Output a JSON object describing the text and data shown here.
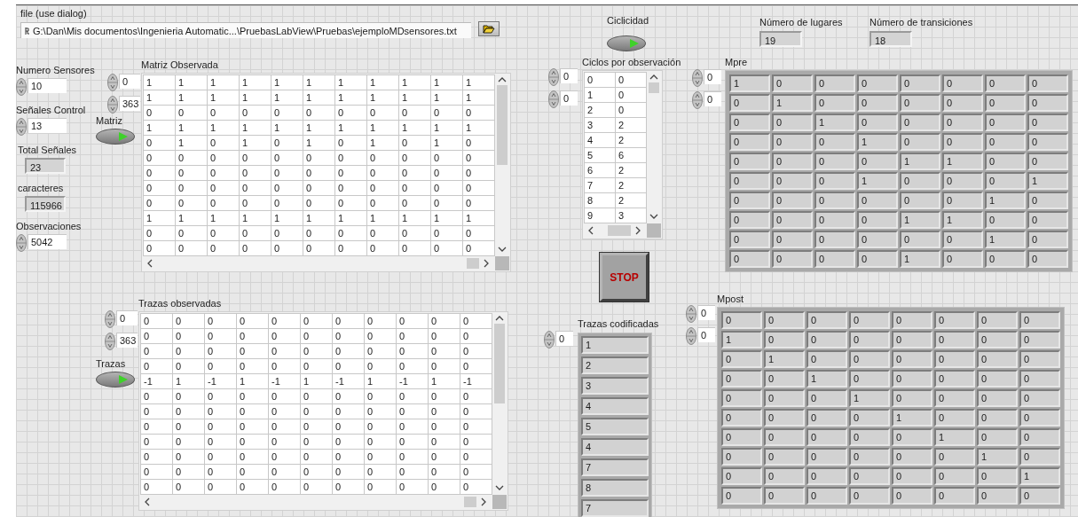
{
  "file_path": {
    "label": "file (use dialog)",
    "value": "G:\\Dan\\Mis documentos\\Ingenieria Automatic...\\PruebasLabView\\Pruebas\\ejemploMDsensores.txt"
  },
  "numerics": [
    {
      "kind": "control",
      "label": "Numero Sensores",
      "value": "10"
    },
    {
      "kind": "control",
      "label": "Señales Control",
      "value": "13"
    },
    {
      "kind": "indicator",
      "label": "Total Señales",
      "value": "23"
    },
    {
      "kind": "indicator",
      "label": "caracteres",
      "value": "115966"
    },
    {
      "kind": "control",
      "label": "Observaciones",
      "value": "5042"
    }
  ],
  "matriz_observada": {
    "label": "Matriz Observada",
    "index": [
      "0",
      "363"
    ],
    "toggle": {
      "label": "Matriz",
      "on": true
    },
    "rows": [
      [
        "1",
        "1",
        "1",
        "1",
        "1",
        "1",
        "1",
        "1",
        "1",
        "1",
        "1"
      ],
      [
        "1",
        "1",
        "1",
        "1",
        "1",
        "1",
        "1",
        "1",
        "1",
        "1",
        "1"
      ],
      [
        "0",
        "0",
        "0",
        "0",
        "0",
        "0",
        "0",
        "0",
        "0",
        "0",
        "0"
      ],
      [
        "1",
        "1",
        "1",
        "1",
        "1",
        "1",
        "1",
        "1",
        "1",
        "1",
        "1"
      ],
      [
        "0",
        "1",
        "0",
        "1",
        "0",
        "1",
        "0",
        "1",
        "0",
        "1",
        "0"
      ],
      [
        "0",
        "0",
        "0",
        "0",
        "0",
        "0",
        "0",
        "0",
        "0",
        "0",
        "0"
      ],
      [
        "0",
        "0",
        "0",
        "0",
        "0",
        "0",
        "0",
        "0",
        "0",
        "0",
        "0"
      ],
      [
        "0",
        "0",
        "0",
        "0",
        "0",
        "0",
        "0",
        "0",
        "0",
        "0",
        "0"
      ],
      [
        "0",
        "0",
        "0",
        "0",
        "0",
        "0",
        "0",
        "0",
        "0",
        "0",
        "0"
      ],
      [
        "1",
        "1",
        "1",
        "1",
        "1",
        "1",
        "1",
        "1",
        "1",
        "1",
        "1"
      ],
      [
        "0",
        "0",
        "0",
        "0",
        "0",
        "0",
        "0",
        "0",
        "0",
        "0",
        "0"
      ],
      [
        "0",
        "0",
        "0",
        "0",
        "0",
        "0",
        "0",
        "0",
        "0",
        "0",
        "0"
      ]
    ]
  },
  "trazas_observadas": {
    "label": "Trazas observadas",
    "index": [
      "0",
      "363"
    ],
    "toggle": {
      "label": "Trazas",
      "on": true
    },
    "rows": [
      [
        "0",
        "0",
        "0",
        "0",
        "0",
        "0",
        "0",
        "0",
        "0",
        "0",
        "0"
      ],
      [
        "0",
        "0",
        "0",
        "0",
        "0",
        "0",
        "0",
        "0",
        "0",
        "0",
        "0"
      ],
      [
        "0",
        "0",
        "0",
        "0",
        "0",
        "0",
        "0",
        "0",
        "0",
        "0",
        "0"
      ],
      [
        "0",
        "0",
        "0",
        "0",
        "0",
        "0",
        "0",
        "0",
        "0",
        "0",
        "0"
      ],
      [
        "-1",
        "1",
        "-1",
        "1",
        "-1",
        "1",
        "-1",
        "1",
        "-1",
        "1",
        "-1"
      ],
      [
        "0",
        "0",
        "0",
        "0",
        "0",
        "0",
        "0",
        "0",
        "0",
        "0",
        "0"
      ],
      [
        "0",
        "0",
        "0",
        "0",
        "0",
        "0",
        "0",
        "0",
        "0",
        "0",
        "0"
      ],
      [
        "0",
        "0",
        "0",
        "0",
        "0",
        "0",
        "0",
        "0",
        "0",
        "0",
        "0"
      ],
      [
        "0",
        "0",
        "0",
        "0",
        "0",
        "0",
        "0",
        "0",
        "0",
        "0",
        "0"
      ],
      [
        "0",
        "0",
        "0",
        "0",
        "0",
        "0",
        "0",
        "0",
        "0",
        "0",
        "0"
      ],
      [
        "0",
        "0",
        "0",
        "0",
        "0",
        "0",
        "0",
        "0",
        "0",
        "0",
        "0"
      ],
      [
        "0",
        "0",
        "0",
        "0",
        "0",
        "0",
        "0",
        "0",
        "0",
        "0",
        "0"
      ]
    ]
  },
  "ciclicidad": {
    "label": "Ciclicidad",
    "on": true
  },
  "ciclos_por_observacion": {
    "label": "Ciclos por observación",
    "index": [
      "0",
      "0"
    ],
    "rows": [
      [
        "0",
        "0"
      ],
      [
        "1",
        "0"
      ],
      [
        "2",
        "0"
      ],
      [
        "3",
        "2"
      ],
      [
        "4",
        "2"
      ],
      [
        "5",
        "6"
      ],
      [
        "6",
        "2"
      ],
      [
        "7",
        "2"
      ],
      [
        "8",
        "2"
      ],
      [
        "9",
        "3"
      ]
    ]
  },
  "stop_button": {
    "label": "STOP"
  },
  "trazas_codificadas": {
    "label": "Trazas codificadas",
    "index": [
      "0"
    ],
    "items": [
      "1",
      "2",
      "3",
      "4",
      "5",
      "4",
      "7",
      "8",
      "7"
    ]
  },
  "numero_lugares": {
    "label": "Número de lugares",
    "value": "19"
  },
  "numero_transiciones": {
    "label": "Número de transiciones",
    "value": "18"
  },
  "mpre": {
    "label": "Mpre",
    "index": [
      "0",
      "0"
    ],
    "rows": [
      [
        "1",
        "0",
        "0",
        "0",
        "0",
        "0",
        "0",
        "0"
      ],
      [
        "0",
        "1",
        "0",
        "0",
        "0",
        "0",
        "0",
        "0"
      ],
      [
        "0",
        "0",
        "1",
        "0",
        "0",
        "0",
        "0",
        "0"
      ],
      [
        "0",
        "0",
        "0",
        "1",
        "0",
        "0",
        "0",
        "0"
      ],
      [
        "0",
        "0",
        "0",
        "0",
        "1",
        "1",
        "0",
        "0"
      ],
      [
        "0",
        "0",
        "0",
        "1",
        "0",
        "0",
        "0",
        "1"
      ],
      [
        "0",
        "0",
        "0",
        "0",
        "0",
        "0",
        "1",
        "0"
      ],
      [
        "0",
        "0",
        "0",
        "0",
        "1",
        "1",
        "0",
        "0"
      ],
      [
        "0",
        "0",
        "0",
        "0",
        "0",
        "0",
        "1",
        "0"
      ],
      [
        "0",
        "0",
        "0",
        "0",
        "1",
        "0",
        "0",
        "0"
      ]
    ]
  },
  "mpost": {
    "label": "Mpost",
    "index": [
      "0",
      "0"
    ],
    "rows": [
      [
        "0",
        "0",
        "0",
        "0",
        "0",
        "0",
        "0",
        "0"
      ],
      [
        "1",
        "0",
        "0",
        "0",
        "0",
        "0",
        "0",
        "0"
      ],
      [
        "0",
        "1",
        "0",
        "0",
        "0",
        "0",
        "0",
        "0"
      ],
      [
        "0",
        "0",
        "1",
        "0",
        "0",
        "0",
        "0",
        "0"
      ],
      [
        "0",
        "0",
        "0",
        "1",
        "0",
        "0",
        "0",
        "0"
      ],
      [
        "0",
        "0",
        "0",
        "0",
        "1",
        "0",
        "0",
        "0"
      ],
      [
        "0",
        "0",
        "0",
        "0",
        "0",
        "1",
        "0",
        "0"
      ],
      [
        "0",
        "0",
        "0",
        "0",
        "0",
        "0",
        "1",
        "0"
      ],
      [
        "0",
        "0",
        "0",
        "0",
        "0",
        "0",
        "0",
        "1"
      ],
      [
        "0",
        "0",
        "0",
        "0",
        "0",
        "0",
        "0",
        "0"
      ]
    ]
  }
}
